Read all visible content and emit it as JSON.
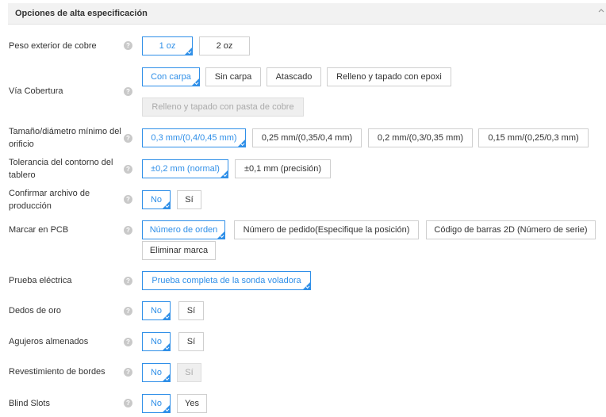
{
  "header": {
    "title": "Opciones de alta especificación"
  },
  "help_icon": "?",
  "rows": [
    {
      "label": "Peso exterior de cobre",
      "options": [
        "1 oz",
        "2 oz"
      ],
      "selected": "1 oz"
    },
    {
      "label": "Vía Cobertura",
      "options": [
        "Con carpa",
        "Sin carpa",
        "Atascado",
        "Relleno y tapado con epoxi",
        "Relleno y tapado con pasta de cobre"
      ],
      "selected": "Con carpa",
      "disabled": [
        "Relleno y tapado con pasta de cobre"
      ]
    },
    {
      "label": "Tamaño/diámetro mínimo del orificio",
      "options": [
        "0,3 mm/(0,4/0,45 mm)",
        "0,25 mm/(0,35/0,4 mm)",
        "0,2 mm/(0,3/0,35 mm)",
        "0,15 mm/(0,25/0,3 mm)"
      ],
      "selected": "0,3 mm/(0,4/0,45 mm)"
    },
    {
      "label": "Tolerancia del contorno del tablero",
      "options": [
        "±0,2 mm (normal)",
        "±0,1 mm (precisión)"
      ],
      "selected": "±0,2 mm (normal)"
    },
    {
      "label": "Confirmar archivo de producción",
      "options": [
        "No",
        "Sí"
      ],
      "selected": "No"
    },
    {
      "label": "Marcar en PCB",
      "options": [
        "Número de orden",
        "Número de pedido(Especifique la posición)",
        "Código de barras 2D (Número de serie)",
        "Eliminar marca"
      ],
      "selected": "Número de orden"
    },
    {
      "label": "Prueba eléctrica",
      "options": [
        "Prueba completa de la sonda voladora"
      ],
      "selected": "Prueba completa de la sonda voladora"
    },
    {
      "label": "Dedos de oro",
      "options": [
        "No",
        "Sí"
      ],
      "selected": "No"
    },
    {
      "label": "Agujeros almenados",
      "options": [
        "No",
        "Sí"
      ],
      "selected": "No"
    },
    {
      "label": "Revestimiento de bordes",
      "options": [
        "No",
        "Sí"
      ],
      "selected": "No",
      "disabled": [
        "Sí"
      ]
    },
    {
      "label": "Blind Slots",
      "options": [
        "No",
        "Yes"
      ],
      "selected": "No"
    }
  ]
}
